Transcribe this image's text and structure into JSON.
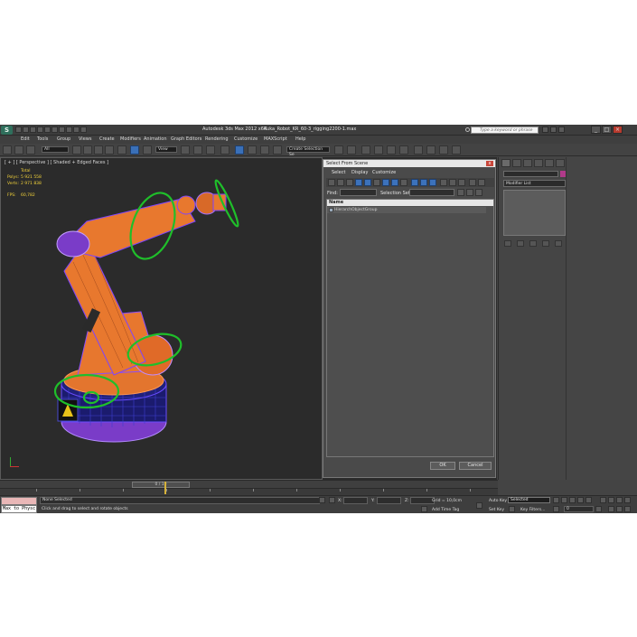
{
  "app": {
    "title": "Autodesk 3ds Max  2012 x64",
    "file": "Kuka_Robot_KR_60-3_rigging2200-1.max",
    "logo": "S",
    "search_placeholder": "Type a keyword or phrase"
  },
  "menu": [
    "Edit",
    "Tools",
    "Group",
    "Views",
    "Create",
    "Modifiers",
    "Animation",
    "Graph Editors",
    "Rendering",
    "Customize",
    "MAXScript",
    "Help"
  ],
  "toolbar": {
    "filter_value": "All",
    "refcoord_value": "View",
    "selection_set_value": "Create Selection Se"
  },
  "viewport": {
    "label": "[ + ] [ Perspective ] [ Shaded + Edged Faces ]",
    "stats_total": "Total",
    "polys_label": "Polys:",
    "polys_value": "5 921 558",
    "verts_label": "Verts:",
    "verts_value": "2 971 838",
    "fps_label": "FPS:",
    "fps_value": "60,782"
  },
  "dialog": {
    "title": "Select From Scene",
    "close": "x",
    "menu": [
      "Select",
      "Display",
      "Customize"
    ],
    "find_label": "Find:",
    "selection_set_label": "Selection Set:",
    "list_header": "Name",
    "rows": [
      "HierarchObjectGroup"
    ],
    "ok": "OK",
    "cancel": "Cancel"
  },
  "command_panel": {
    "modifier_list": "Modifier List"
  },
  "timeline": {
    "frame_label": "0 / 10",
    "ticks": [
      "0",
      "1",
      "2",
      "3",
      "4",
      "5",
      "6",
      "7",
      "8",
      "9",
      "10"
    ]
  },
  "status": {
    "maxscript_prompt": "Max to Physc",
    "selection": "None Selected",
    "prompt": "Click and drag to select and rotate objects",
    "x_label": "X:",
    "y_label": "Y:",
    "z_label": "Z:",
    "grid": "Grid = 10,0cm",
    "add_time_tag": "Add Time Tag",
    "auto_key": "Auto Key",
    "selected": "Selected",
    "set_key": "Set Key",
    "key_filters": "Key Filters...",
    "frame_num": "0"
  }
}
